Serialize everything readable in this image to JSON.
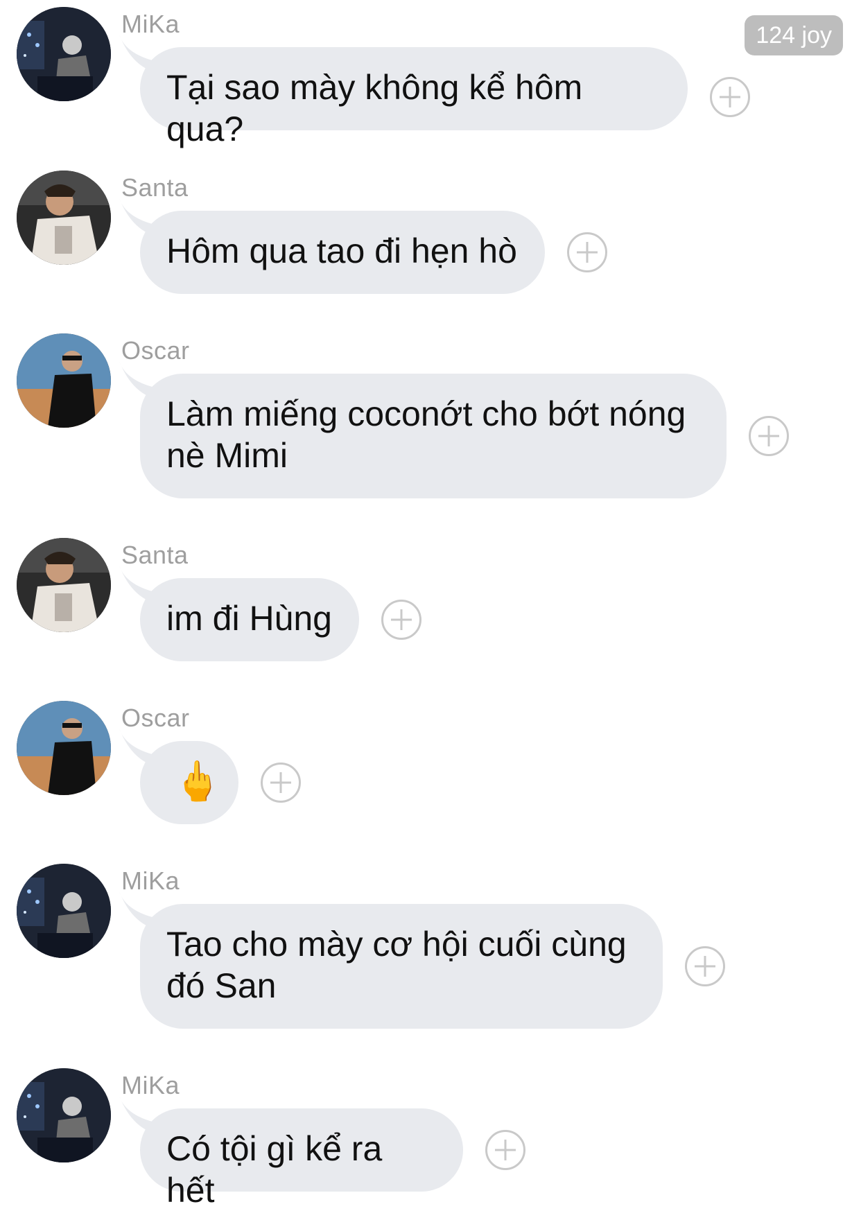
{
  "badge": {
    "label": "124 joy"
  },
  "messages": [
    {
      "sender": "MiKa",
      "text": "Tại sao mày không kể hôm qua?",
      "avatar": "mika-avatar"
    },
    {
      "sender": "Santa",
      "text": "Hôm qua tao đi hẹn hò",
      "avatar": "santa-avatar"
    },
    {
      "sender": "Oscar",
      "text": "Làm miếng coconớt cho bớt nóng\nnè Mimi",
      "avatar": "oscar-avatar"
    },
    {
      "sender": "Santa",
      "text": "im đi Hùng",
      "avatar": "santa-avatar"
    },
    {
      "sender": "Oscar",
      "text": "🖕",
      "avatar": "oscar-avatar"
    },
    {
      "sender": "MiKa",
      "text": "Tao cho mày cơ hội cuối cùng\nđó San",
      "avatar": "mika-avatar"
    },
    {
      "sender": "MiKa",
      "text": "Có tội gì kể ra hết",
      "avatar": "mika-avatar"
    }
  ],
  "icons": {
    "react": "add-reaction-icon"
  }
}
